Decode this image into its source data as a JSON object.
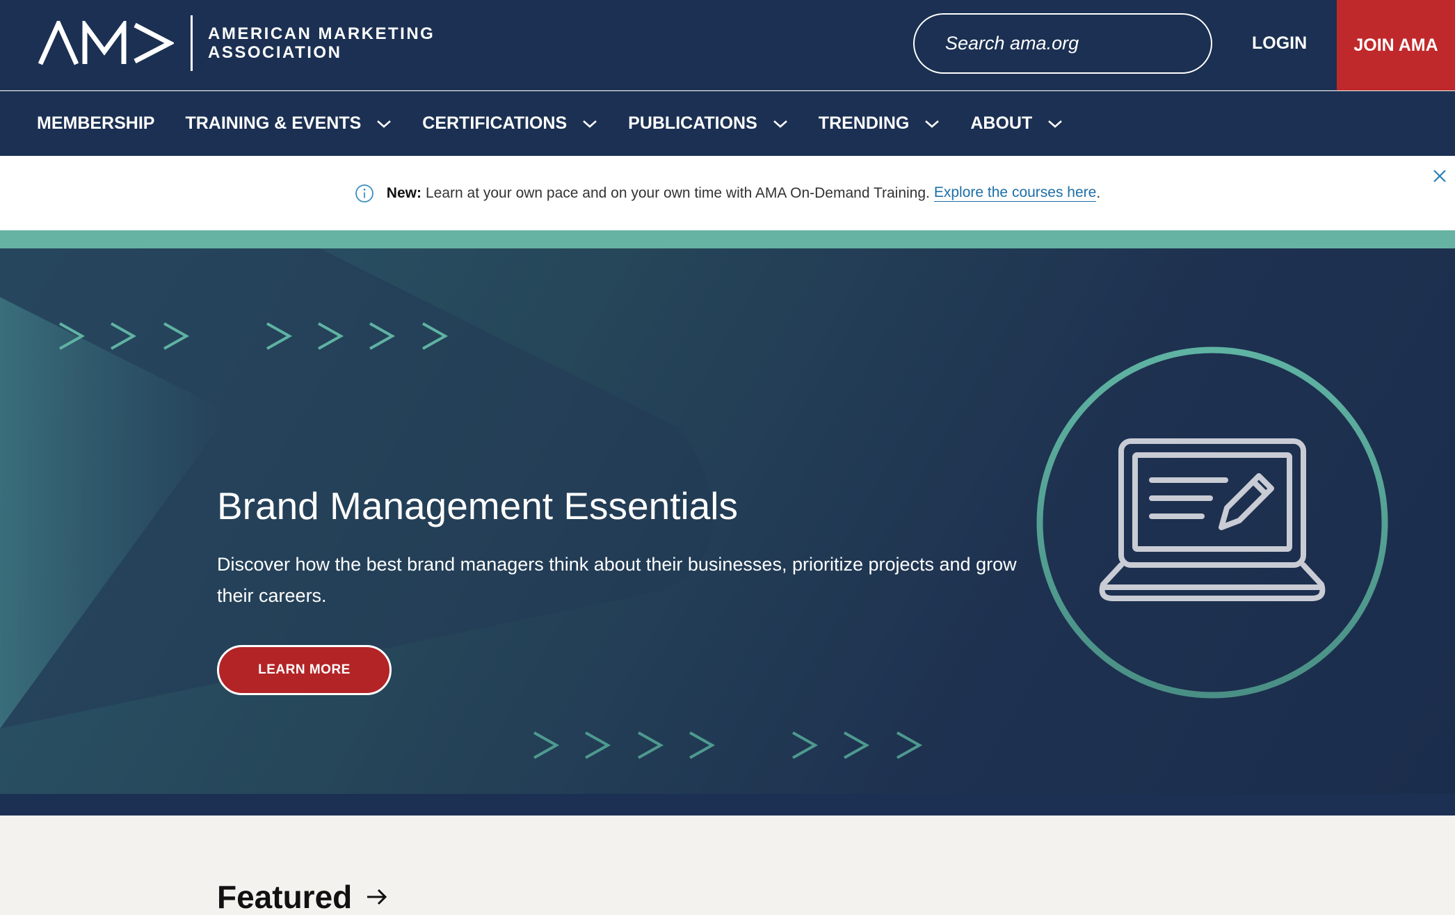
{
  "header": {
    "logo_text_line1": "AMERICAN MARKETING",
    "logo_text_line2": "ASSOCIATION",
    "search_placeholder": "Search ama.org",
    "login_label": "LOGIN",
    "join_label": "JOIN AMA"
  },
  "nav": {
    "items": [
      {
        "label": "MEMBERSHIP"
      },
      {
        "label": "TRAINING & EVENTS"
      },
      {
        "label": "CERTIFICATIONS"
      },
      {
        "label": "PUBLICATIONS"
      },
      {
        "label": "TRENDING"
      },
      {
        "label": "ABOUT"
      }
    ]
  },
  "alert": {
    "prefix": "New:",
    "message": "Learn at your own pace and on your own time with AMA On-Demand Training.",
    "link_text": "Explore the courses here",
    "suffix": "."
  },
  "hero": {
    "title": "Brand Management Essentials",
    "description": "Discover how the best brand managers think about their businesses, prioritize projects and grow their careers.",
    "button_label": "LEARN MORE",
    "icon": "laptop-pencil-icon"
  },
  "featured": {
    "heading": "Featured"
  },
  "colors": {
    "navy": "#1b3052",
    "red": "#c0292b",
    "teal": "#66b3a3",
    "link": "#1d6ea7"
  }
}
